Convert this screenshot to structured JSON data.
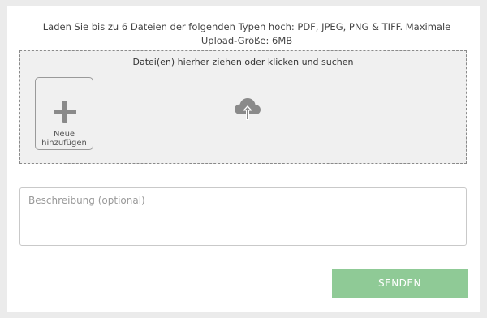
{
  "upload": {
    "info_text": "Laden Sie bis zu 6 Dateien der folgenden Typen hoch: PDF, JPEG, PNG & TIFF. Maximale Upload-Größe: 6MB",
    "dropzone_text": "Datei(en) hierher ziehen oder klicken und suchen",
    "add_new_line1": "Neue",
    "add_new_line2": "hinzufügen",
    "add_icon": "plus-icon",
    "upload_icon": "cloud-upload-icon"
  },
  "form": {
    "description_placeholder": "Beschreibung (optional)",
    "description_value": "",
    "submit_label": "SENDEN",
    "submit_color": "#8fca96"
  }
}
